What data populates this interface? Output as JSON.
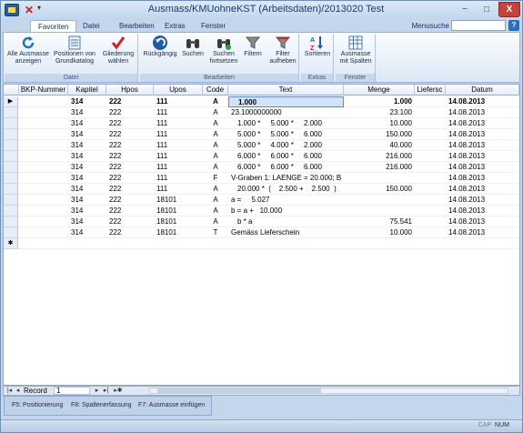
{
  "window": {
    "title": "Ausmass/KMUohneKST (Arbeitsdaten)/2013020 Test",
    "minimize": "−",
    "maximize": "□",
    "close": "X"
  },
  "qat": {
    "undo": "✕",
    "more": "▾"
  },
  "tabs": [
    "Favoriten",
    "Datei",
    "Bearbeiten",
    "Extras",
    "Fenster"
  ],
  "menusuche": {
    "label": "Menusuche",
    "value": ""
  },
  "ribbon": {
    "groups": [
      {
        "label": "Datei"
      },
      {
        "label": "Bearbeiten"
      },
      {
        "label": "Extras"
      },
      {
        "label": "Fenster"
      }
    ],
    "buttons": [
      {
        "label": "Alle Ausmasse\nanzeigen",
        "icon": "refresh-icon"
      },
      {
        "label": "Positionen von\nGrundkatalog",
        "icon": "catalog-icon"
      },
      {
        "label": "Gliederung\nwählen",
        "icon": "checkmark-icon"
      },
      {
        "label": "Rückgängig",
        "icon": "undo-icon"
      },
      {
        "label": "Suchen",
        "icon": "binoculars-icon"
      },
      {
        "label": "Suchen\nfortsetzen",
        "icon": "binoculars-next-icon"
      },
      {
        "label": "Filtern",
        "icon": "filter-icon"
      },
      {
        "label": "Filter\naufheben",
        "icon": "filter-remove-icon"
      },
      {
        "label": "Sortieren",
        "icon": "sort-az-icon"
      },
      {
        "label": "Ausmasse\nmit Spalten",
        "icon": "columns-icon"
      }
    ]
  },
  "grid": {
    "headers": [
      "BKP-Nummer",
      "Kapitel",
      "Hpos",
      "Upos",
      "Code",
      "Text",
      "Menge",
      "Liefersc",
      "Datum"
    ],
    "rows": [
      {
        "sel": "▶",
        "bkp": "",
        "kapitel": "314",
        "hpos": "222",
        "upos": "111",
        "code": "A",
        "text": "1.000",
        "menge": "1.000",
        "liefer": "",
        "datum": "14.08.2013"
      },
      {
        "sel": "",
        "bkp": "",
        "kapitel": "314",
        "hpos": "222",
        "upos": "111",
        "code": "A",
        "text": "23.1000000000",
        "menge": "23.100",
        "liefer": "",
        "datum": "14.08.2013"
      },
      {
        "sel": "",
        "bkp": "",
        "kapitel": "314",
        "hpos": "222",
        "upos": "111",
        "code": "A",
        "text": "1.000 *     5.000 *     2.000",
        "menge": "10.000",
        "liefer": "",
        "datum": "14.08.2013"
      },
      {
        "sel": "",
        "bkp": "",
        "kapitel": "314",
        "hpos": "222",
        "upos": "111",
        "code": "A",
        "text": "5.000 *     5.000 *     6.000",
        "menge": "150.000",
        "liefer": "",
        "datum": "14.08.2013"
      },
      {
        "sel": "",
        "bkp": "",
        "kapitel": "314",
        "hpos": "222",
        "upos": "111",
        "code": "A",
        "text": "5.000 *     4.000 *     2.000",
        "menge": "40.000",
        "liefer": "",
        "datum": "14.08.2013"
      },
      {
        "sel": "",
        "bkp": "",
        "kapitel": "314",
        "hpos": "222",
        "upos": "111",
        "code": "A",
        "text": "6.000 *     6.000 *     6.000",
        "menge": "216.000",
        "liefer": "",
        "datum": "14.08.2013"
      },
      {
        "sel": "",
        "bkp": "",
        "kapitel": "314",
        "hpos": "222",
        "upos": "111",
        "code": "A",
        "text": "6.000 *     6.000 *     6.000",
        "menge": "216.000",
        "liefer": "",
        "datum": "14.08.2013"
      },
      {
        "sel": "",
        "bkp": "",
        "kapitel": "314",
        "hpos": "222",
        "upos": "111",
        "code": "F",
        "text": "V-Graben 1: LAENGE = 20.000; B",
        "menge": "",
        "liefer": "",
        "datum": "14.08.2013"
      },
      {
        "sel": "",
        "bkp": "",
        "kapitel": "314",
        "hpos": "222",
        "upos": "111",
        "code": "A",
        "text": "20.000 *  (    2.500 +    2.500  )",
        "menge": "150.000",
        "liefer": "",
        "datum": "14.08.2013"
      },
      {
        "sel": "",
        "bkp": "",
        "kapitel": "314",
        "hpos": "222",
        "upos": "18101",
        "code": "A",
        "text": "a =     5.027",
        "menge": "",
        "liefer": "",
        "datum": "14.08.2013"
      },
      {
        "sel": "",
        "bkp": "",
        "kapitel": "314",
        "hpos": "222",
        "upos": "18101",
        "code": "A",
        "text": "b = a +   10.000",
        "menge": "",
        "liefer": "",
        "datum": "14.08.2013"
      },
      {
        "sel": "",
        "bkp": "",
        "kapitel": "314",
        "hpos": "222",
        "upos": "18101",
        "code": "A",
        "text": "b * a",
        "menge": "75.541",
        "liefer": "",
        "datum": "14.08.2013"
      },
      {
        "sel": "",
        "bkp": "",
        "kapitel": "314",
        "hpos": "222",
        "upos": "18101",
        "code": "T",
        "text": "Gemäss Lieferschein",
        "menge": "10.000",
        "liefer": "",
        "datum": "14.08.2013"
      },
      {
        "sel": "✱",
        "bkp": "",
        "kapitel": "",
        "hpos": "",
        "upos": "",
        "code": "",
        "text": "",
        "menge": "",
        "liefer": "",
        "datum": ""
      }
    ]
  },
  "nav": {
    "first": "|◂",
    "prev": "◂",
    "record_label": "Record",
    "record_value": "1",
    "next": "▸",
    "last": "▸|",
    "new": "▸✱"
  },
  "fkeys": [
    "F5: Positionierung",
    "F8: Spaltenerfassung",
    "F7: Ausmasse einfügen"
  ],
  "status": {
    "caps": "CAP",
    "num": "NUM"
  }
}
